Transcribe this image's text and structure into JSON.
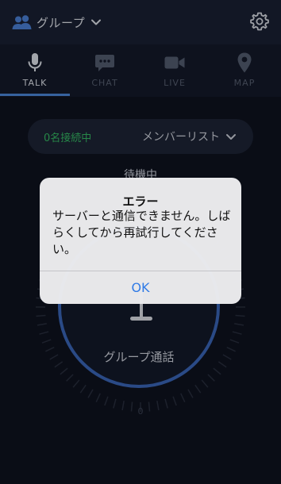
{
  "header": {
    "group_label": "グループ",
    "people_icon": "people-icon",
    "chevron_icon": "chevron-down-icon",
    "settings_icon": "gear-icon"
  },
  "tabs": [
    {
      "label": "TALK",
      "icon": "microphone-icon",
      "active": true
    },
    {
      "label": "CHAT",
      "icon": "chat-bubble-icon",
      "active": false
    },
    {
      "label": "LIVE",
      "icon": "video-camera-icon",
      "active": false
    },
    {
      "label": "MAP",
      "icon": "map-pin-icon",
      "active": false
    }
  ],
  "members": {
    "connection_status": "0名接続中",
    "member_list_label": "メンバーリスト"
  },
  "status": {
    "standby": "待機中"
  },
  "talk": {
    "group_call_label": "グループ通話",
    "level_value": "0"
  },
  "alert": {
    "title": "エラー",
    "message": "サーバーと通信できません。しばらくしてから再試行してください。",
    "ok_label": "OK"
  },
  "colors": {
    "accent": "#4f8de3",
    "connected": "#37c067",
    "alert_button": "#2f7ae6",
    "background": "#0f1320"
  }
}
